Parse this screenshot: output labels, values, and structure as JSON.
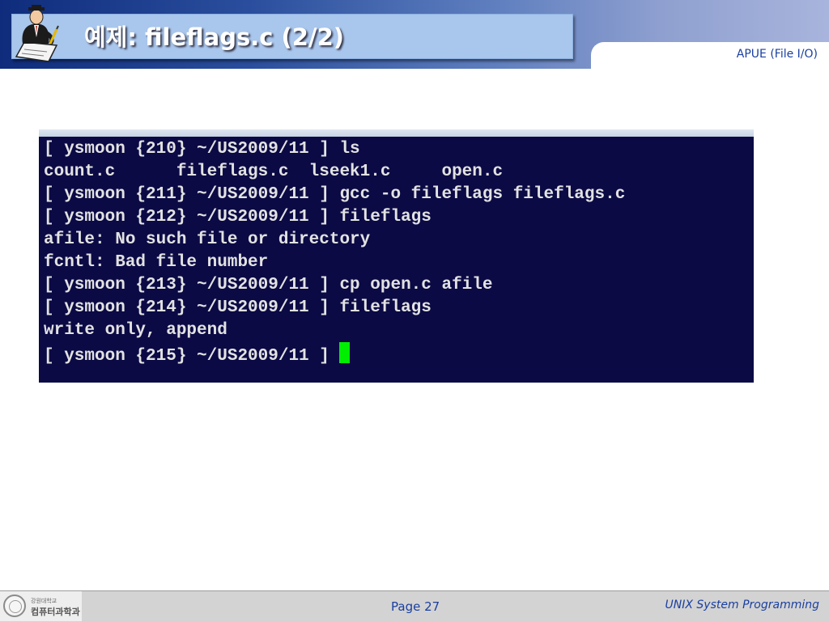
{
  "header": {
    "title": "예제: fileflags.c (2/2)",
    "subject": "APUE (File I/O)",
    "logo_icon": "writer-at-desk-icon"
  },
  "terminal": {
    "lines": [
      "[ ysmoon {210} ~/US2009/11 ] ls",
      "count.c      fileflags.c  lseek1.c     open.c",
      "[ ysmoon {211} ~/US2009/11 ] gcc -o fileflags fileflags.c",
      "[ ysmoon {212} ~/US2009/11 ] fileflags",
      "afile: No such file or directory",
      "fcntl: Bad file number",
      "[ ysmoon {213} ~/US2009/11 ] cp open.c afile",
      "[ ysmoon {214} ~/US2009/11 ] fileflags",
      "write only, append",
      "[ ysmoon {215} ~/US2009/11 ] "
    ],
    "cursor_color": "#00ee00",
    "background": "#0b0a45"
  },
  "footer": {
    "university_small": "강원대학교",
    "department": "컴퓨터과학과",
    "page": "Page 27",
    "course": "UNIX System Programming"
  },
  "colors": {
    "accent": "#1a3fa0",
    "title_box": "#a9c6ec"
  }
}
